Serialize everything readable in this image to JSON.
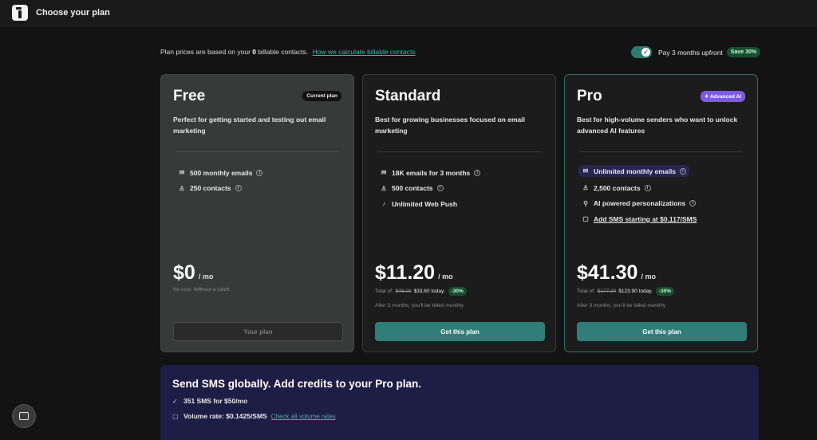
{
  "header": {
    "logo_icon": "brand-logo-icon",
    "title": "Choose your plan"
  },
  "intro": {
    "text_prefix": "Plan prices are based on your ",
    "contacts_count": "0",
    "text_suffix": " billable contacts.",
    "link": "How we calculate billable contacts"
  },
  "billing_toggle": {
    "label": "Pay 3 months upfront",
    "badge": "Save 30%",
    "checked": true
  },
  "plans": [
    {
      "name": "Free",
      "badge": "Current plan",
      "description": "Perfect for getting started and testing out email marketing",
      "features": [
        {
          "icon": "mail-icon",
          "text": "500 monthly emails"
        },
        {
          "icon": "user-icon",
          "text": "250 contacts"
        }
      ],
      "price": "$0",
      "period": "/ mo",
      "note": "No cost. Without a catch.",
      "cta": "Your plan"
    },
    {
      "name": "Standard",
      "description": "Best for growing businesses focused on email marketing",
      "features": [
        {
          "icon": "mail-icon",
          "text": "18K emails for 3 months"
        },
        {
          "icon": "user-icon",
          "text": "500 contacts"
        },
        {
          "icon": "bell-icon",
          "text": "Unlimited Web Push"
        }
      ],
      "price": "$11.20",
      "period": "/ mo",
      "total_label": "Total of:",
      "total_old": "$48.00",
      "total_new": "$33.60 today.",
      "discount": "-30%",
      "billing_note": "After 3 months, you'll be billed monthly",
      "cta": "Get this plan"
    },
    {
      "name": "Pro",
      "badge": "Advanced AI",
      "description": "Best for high-volume senders who want to unlock advanced AI features",
      "features": [
        {
          "icon": "mail-icon",
          "text": "Unlimited monthly emails"
        },
        {
          "icon": "user-icon",
          "text": "2,500 contacts"
        },
        {
          "icon": "magic-wand-icon",
          "text": "AI powered personalizations"
        },
        {
          "icon": "sms-icon",
          "text": "Add SMS starting at $0.117/SMS"
        }
      ],
      "price": "$41.30",
      "period": "/ mo",
      "total_label": "Total of:",
      "total_old": "$177.00",
      "total_new": "$123.90 today.",
      "discount": "-30%",
      "billing_note": "After 3 months, you'll be billed monthly",
      "cta": "Get this plan"
    }
  ],
  "sms": {
    "title": "Send SMS globally. Add credits to your Pro plan.",
    "line1": "351 SMS for $50/mo",
    "line2": "Volume rate: $0.1425/SMS",
    "link": "Check all volume rates"
  },
  "chat": {
    "icon": "chat-icon"
  },
  "colors": {
    "accent": "#2f7e77",
    "link": "#3fb5a8",
    "ai_badge": "#7c5be0",
    "save_badge": "#174f2e",
    "sms_panel": "#1d1d45"
  }
}
